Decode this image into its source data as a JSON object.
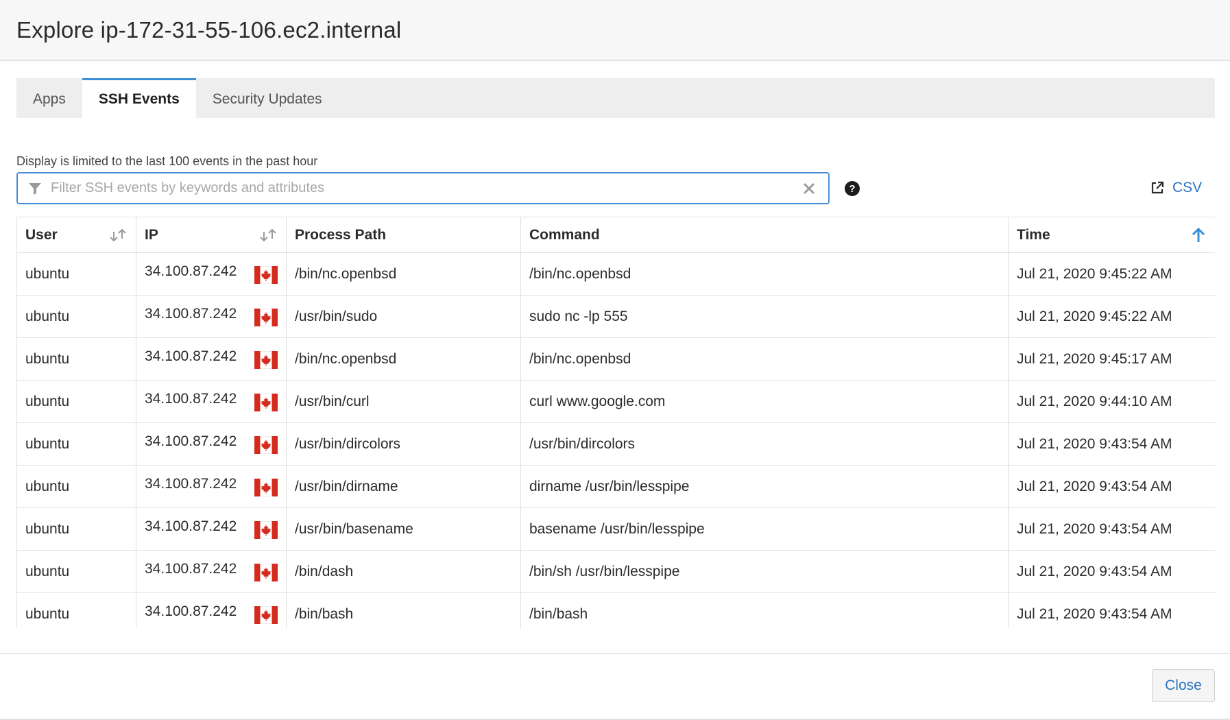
{
  "modal": {
    "title": "Explore ip-172-31-55-106.ec2.internal"
  },
  "tabs": [
    {
      "label": "Apps",
      "active": false
    },
    {
      "label": "SSH Events",
      "active": true
    },
    {
      "label": "Security Updates",
      "active": false
    }
  ],
  "hint": "Display is limited to the last 100 events in the past hour",
  "filter": {
    "placeholder": "Filter SSH events by keywords and attributes",
    "value": ""
  },
  "csv_label": "CSV",
  "table": {
    "columns": [
      "User",
      "IP",
      "Process Path",
      "Command",
      "Time"
    ],
    "rows": [
      {
        "user": "ubuntu",
        "ip": "34.100.87.242",
        "flag": "canada-flag-icon",
        "process_path": "/bin/nc.openbsd",
        "command": "/bin/nc.openbsd",
        "time": "Jul 21, 2020 9:45:22 AM"
      },
      {
        "user": "ubuntu",
        "ip": "34.100.87.242",
        "flag": "canada-flag-icon",
        "process_path": "/usr/bin/sudo",
        "command": "sudo nc -lp 555",
        "time": "Jul 21, 2020 9:45:22 AM"
      },
      {
        "user": "ubuntu",
        "ip": "34.100.87.242",
        "flag": "canada-flag-icon",
        "process_path": "/bin/nc.openbsd",
        "command": "/bin/nc.openbsd",
        "time": "Jul 21, 2020 9:45:17 AM"
      },
      {
        "user": "ubuntu",
        "ip": "34.100.87.242",
        "flag": "canada-flag-icon",
        "process_path": "/usr/bin/curl",
        "command": "curl www.google.com",
        "time": "Jul 21, 2020 9:44:10 AM"
      },
      {
        "user": "ubuntu",
        "ip": "34.100.87.242",
        "flag": "canada-flag-icon",
        "process_path": "/usr/bin/dircolors",
        "command": "/usr/bin/dircolors",
        "time": "Jul 21, 2020 9:43:54 AM"
      },
      {
        "user": "ubuntu",
        "ip": "34.100.87.242",
        "flag": "canada-flag-icon",
        "process_path": "/usr/bin/dirname",
        "command": "dirname /usr/bin/lesspipe",
        "time": "Jul 21, 2020 9:43:54 AM"
      },
      {
        "user": "ubuntu",
        "ip": "34.100.87.242",
        "flag": "canada-flag-icon",
        "process_path": "/usr/bin/basename",
        "command": "basename /usr/bin/lesspipe",
        "time": "Jul 21, 2020 9:43:54 AM"
      },
      {
        "user": "ubuntu",
        "ip": "34.100.87.242",
        "flag": "canada-flag-icon",
        "process_path": "/bin/dash",
        "command": "/bin/sh /usr/bin/lesspipe",
        "time": "Jul 21, 2020 9:43:54 AM"
      },
      {
        "user": "ubuntu",
        "ip": "34.100.87.242",
        "flag": "canada-flag-icon",
        "process_path": "/bin/bash",
        "command": "/bin/bash",
        "time": "Jul 21, 2020 9:43:54 AM"
      }
    ]
  },
  "close_label": "Close",
  "colors": {
    "accent": "#3b8fd9",
    "link": "#2b74c2",
    "flag_red": "#d52b1e"
  },
  "icons": {
    "filter": "filter-funnel-icon",
    "clear": "clear-x-icon",
    "help": "question-circle-icon",
    "export": "external-link-icon",
    "sort": "sort-arrows-icon",
    "sort_active": "sort-ascending-arrow-icon"
  }
}
